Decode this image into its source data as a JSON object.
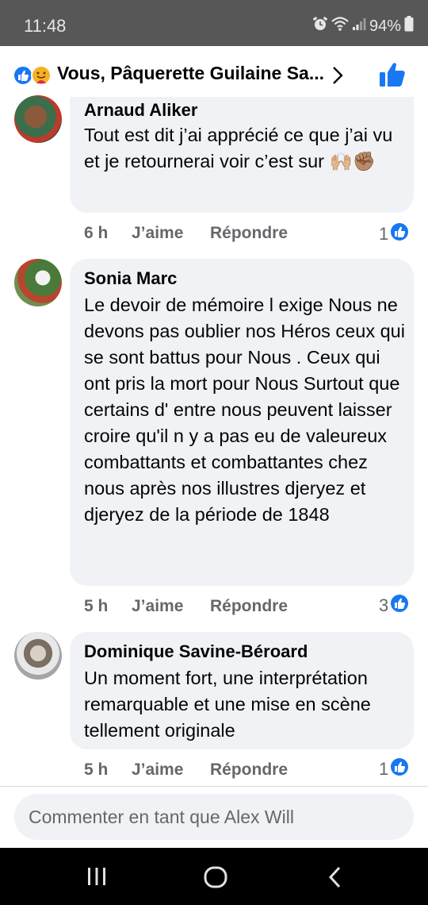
{
  "status_bar": {
    "time": "11:48",
    "battery": "94%"
  },
  "header": {
    "title": "Vous, Pâquerette Guilaine Sa...",
    "reaction_icons": [
      "like-reaction-icon",
      "care-reaction-icon"
    ]
  },
  "comments": [
    {
      "author": "Arnaud Aliker",
      "text": "Tout est dit j’ai apprécié ce que j’ai vu et je retournerai voir c’est sur 🙌🏼✊🏽",
      "time": "6 h",
      "like_label": "J’aime",
      "reply_label": "Répondre",
      "like_count": "1"
    },
    {
      "author": "Sonia Marc",
      "text": "Le devoir de mémoire l exige Nous ne devons pas oublier nos Héros ceux qui se sont battus pour Nous . Ceux qui ont pris la mort pour Nous Surtout que certains d' entre nous peuvent laisser croire qu'il n y a pas eu de valeureux combattants et combattantes chez nous après nos illustres djeryez et djeryez de la période de 1848",
      "time": "5 h",
      "like_label": "J’aime",
      "reply_label": "Répondre",
      "like_count": "3"
    },
    {
      "author": "Dominique Savine-Béroard",
      "text": "Un moment fort, une interprétation remarquable et une mise en scène tellement originale",
      "time": "5 h",
      "like_label": "J’aime",
      "reply_label": "Répondre",
      "like_count": "1"
    }
  ],
  "composer": {
    "placeholder": "Commenter en tant que Alex Will"
  },
  "colors": {
    "facebook_blue": "#1877f2",
    "bubble_bg": "#f0f2f5",
    "secondary_text": "#65676b",
    "status_bar_bg": "#575757"
  }
}
